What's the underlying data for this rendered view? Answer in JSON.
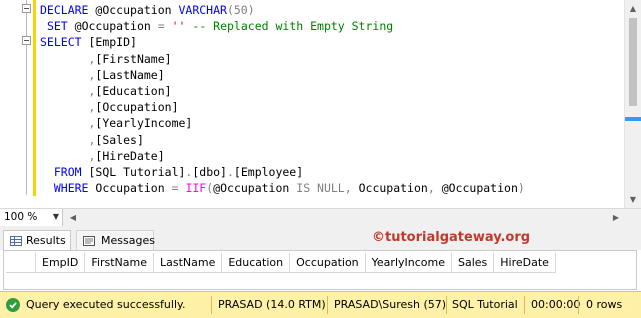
{
  "editor": {
    "lines": [
      {
        "indent": "",
        "tokens": [
          {
            "t": "DECLARE",
            "c": "kw"
          },
          {
            "t": " @Occupation ",
            "c": ""
          },
          {
            "t": "VARCHAR",
            "c": "kw"
          },
          {
            "t": "(50)",
            "c": "gr"
          }
        ]
      },
      {
        "indent": " ",
        "tokens": [
          {
            "t": "SET",
            "c": "kw"
          },
          {
            "t": " @Occupation ",
            "c": ""
          },
          {
            "t": "=",
            "c": "gr"
          },
          {
            "t": " ",
            "c": ""
          },
          {
            "t": "''",
            "c": "str"
          },
          {
            "t": " -- Replaced with Empty String",
            "c": "cmt"
          }
        ]
      },
      {
        "indent": "",
        "tokens": [
          {
            "t": "SELECT",
            "c": "kw"
          },
          {
            "t": " [EmpID]",
            "c": ""
          }
        ]
      },
      {
        "indent": "       ",
        "tokens": [
          {
            "t": ",",
            "c": "gr"
          },
          {
            "t": "[FirstName]",
            "c": ""
          }
        ]
      },
      {
        "indent": "       ",
        "tokens": [
          {
            "t": ",",
            "c": "gr"
          },
          {
            "t": "[LastName]",
            "c": ""
          }
        ]
      },
      {
        "indent": "       ",
        "tokens": [
          {
            "t": ",",
            "c": "gr"
          },
          {
            "t": "[Education]",
            "c": ""
          }
        ]
      },
      {
        "indent": "       ",
        "tokens": [
          {
            "t": ",",
            "c": "gr"
          },
          {
            "t": "[Occupation]",
            "c": ""
          }
        ]
      },
      {
        "indent": "       ",
        "tokens": [
          {
            "t": ",",
            "c": "gr"
          },
          {
            "t": "[YearlyIncome]",
            "c": ""
          }
        ]
      },
      {
        "indent": "       ",
        "tokens": [
          {
            "t": ",",
            "c": "gr"
          },
          {
            "t": "[Sales]",
            "c": ""
          }
        ]
      },
      {
        "indent": "       ",
        "tokens": [
          {
            "t": ",",
            "c": "gr"
          },
          {
            "t": "[HireDate]",
            "c": ""
          }
        ]
      },
      {
        "indent": "  ",
        "tokens": [
          {
            "t": "FROM",
            "c": "kw"
          },
          {
            "t": " [SQL Tutorial]",
            "c": ""
          },
          {
            "t": ".",
            "c": "gr"
          },
          {
            "t": "[dbo]",
            "c": ""
          },
          {
            "t": ".",
            "c": "gr"
          },
          {
            "t": "[Employee]",
            "c": ""
          }
        ]
      },
      {
        "indent": "  ",
        "tokens": [
          {
            "t": "WHERE",
            "c": "kw"
          },
          {
            "t": " Occupation ",
            "c": ""
          },
          {
            "t": "=",
            "c": "gr"
          },
          {
            "t": " ",
            "c": ""
          },
          {
            "t": "IIF",
            "c": "fn"
          },
          {
            "t": "(",
            "c": "gr"
          },
          {
            "t": "@Occupation ",
            "c": ""
          },
          {
            "t": "IS NULL",
            "c": "gr"
          },
          {
            "t": ",",
            "c": "gr"
          },
          {
            "t": " Occupation",
            "c": ""
          },
          {
            "t": ",",
            "c": "gr"
          },
          {
            "t": " @Occupation",
            "c": ""
          },
          {
            "t": ")",
            "c": "gr"
          }
        ]
      }
    ]
  },
  "toolbar": {
    "zoom": "100 %"
  },
  "results": {
    "tabs": [
      {
        "label": "Results",
        "active": true
      },
      {
        "label": "Messages",
        "active": false
      }
    ],
    "brand": "©tutorialgateway.org",
    "columns": [
      "EmpID",
      "FirstName",
      "LastName",
      "Education",
      "Occupation",
      "YearlyIncome",
      "Sales",
      "HireDate"
    ]
  },
  "status": {
    "message": "Query executed successfully.",
    "server": "PRASAD (14.0 RTM)",
    "user": "PRASAD\\Suresh (57)",
    "database": "SQL Tutorial",
    "elapsed": "00:00:00",
    "rows": "0 rows"
  },
  "colors": {
    "keyword": "#0000ff",
    "string": "#ff0000",
    "comment": "#008000",
    "status_bg": "#fff1a8",
    "brand": "#c03a2b"
  }
}
